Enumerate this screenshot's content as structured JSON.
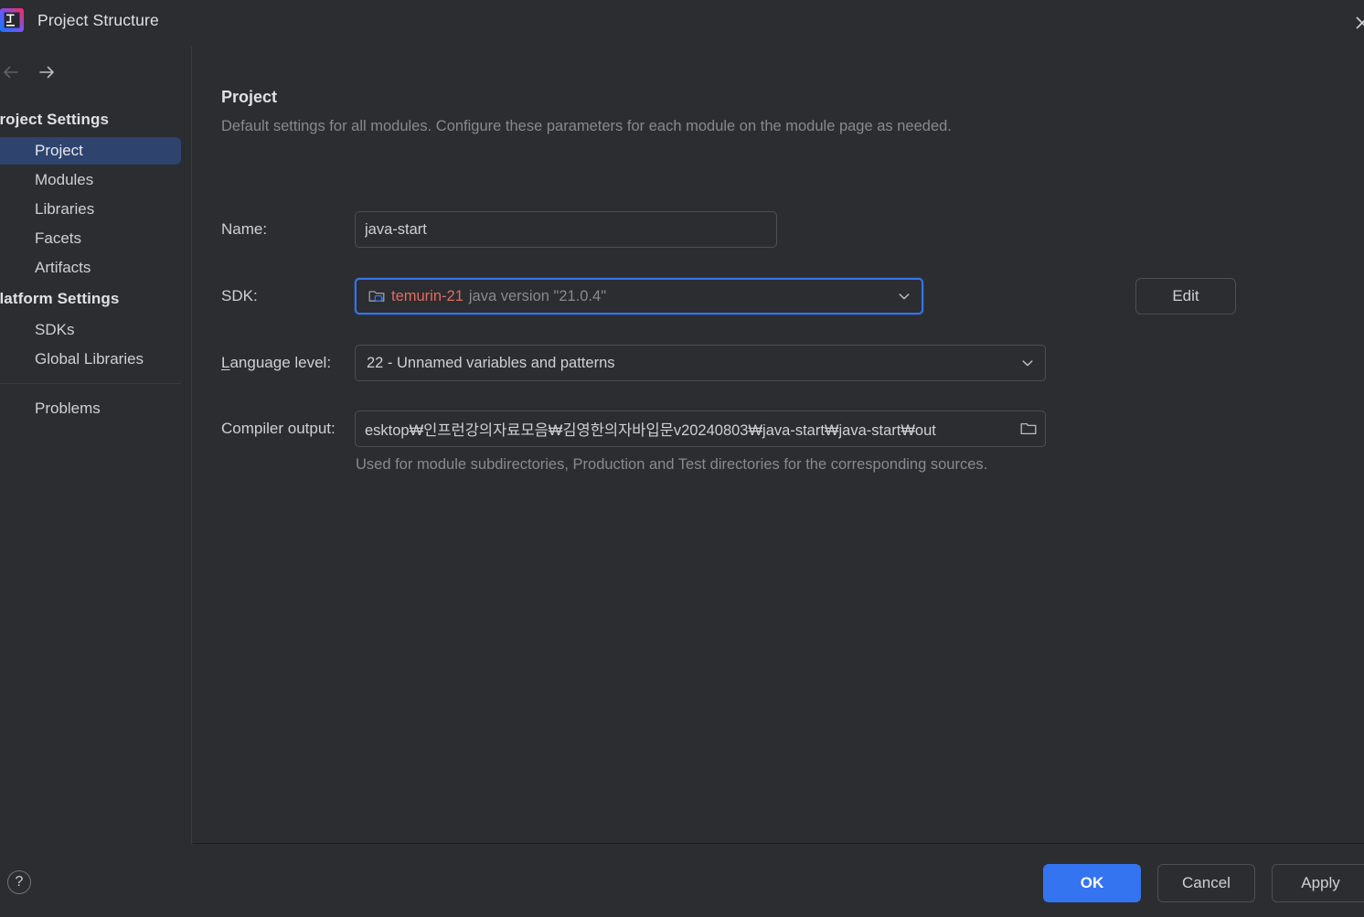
{
  "window": {
    "title": "Project Structure",
    "logo_icon": "intellij-idea-logo",
    "close_icon": "close-icon"
  },
  "nav": {
    "back_icon": "arrow-left-icon",
    "forward_icon": "arrow-right-icon"
  },
  "sidebar": {
    "groups": [
      {
        "label": "Project Settings",
        "items": [
          {
            "label": "Project",
            "selected": true
          },
          {
            "label": "Modules",
            "selected": false
          },
          {
            "label": "Libraries",
            "selected": false
          },
          {
            "label": "Facets",
            "selected": false
          },
          {
            "label": "Artifacts",
            "selected": false
          }
        ]
      },
      {
        "label": "Platform Settings",
        "items": [
          {
            "label": "SDKs",
            "selected": false
          },
          {
            "label": "Global Libraries",
            "selected": false
          }
        ]
      }
    ],
    "standalone": {
      "label": "Problems"
    }
  },
  "main": {
    "title": "Project",
    "subtitle": "Default settings for all modules. Configure these parameters for each module on the module page as needed.",
    "name_row": {
      "label": "Name:",
      "value": "java-start"
    },
    "sdk_row": {
      "label": "SDK:",
      "icon": "jdk-folder-icon",
      "sdk_name": "temurin-21",
      "sdk_version": "java version \"21.0.4\"",
      "dropdown_icon": "chevron-down-icon",
      "edit_label": "Edit"
    },
    "language_level_row": {
      "label_mnemonic": "L",
      "label_rest": "anguage level:",
      "value": "22 - Unnamed variables and patterns",
      "dropdown_icon": "chevron-down-icon"
    },
    "compiler_output_row": {
      "label": "Compiler output:",
      "value": "esktop₩인프런강의자료모음₩김영한의자바입문v20240803₩java-start₩java-start₩out",
      "browse_icon": "folder-browse-icon",
      "helper_text": "Used for module subdirectories, Production and Test directories for the corresponding sources."
    }
  },
  "footer": {
    "help_label": "?",
    "help_icon": "question-mark-icon",
    "buttons": [
      {
        "label": "OK",
        "primary": true
      },
      {
        "label": "Cancel",
        "primary": false
      },
      {
        "label": "Apply",
        "primary": false
      }
    ]
  },
  "colors": {
    "window_bg": "#2B2D30",
    "accent_blue": "#3574F0",
    "selection_blue": "#2E436E",
    "sdk_red": "#E06C63",
    "text_primary": "#CED0D6",
    "text_muted": "#868A91",
    "border": "#4C5052"
  }
}
